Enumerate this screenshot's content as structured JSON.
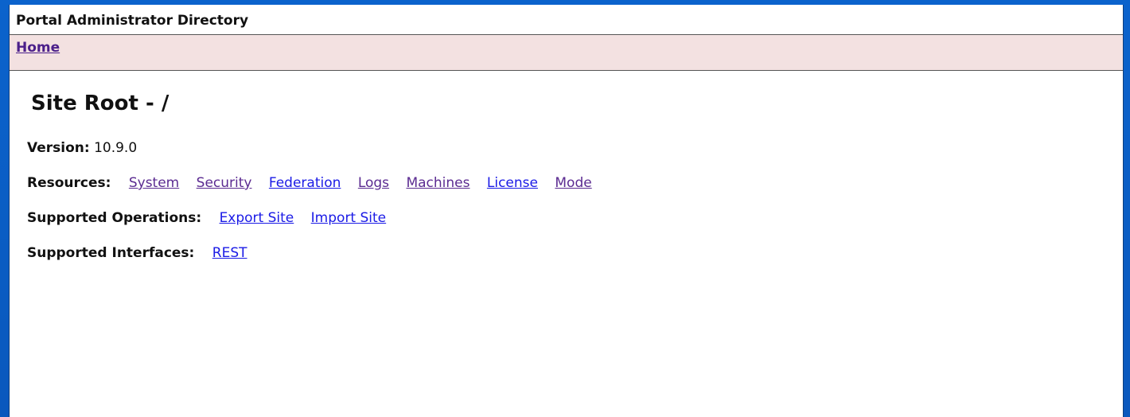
{
  "header": {
    "title": "Portal Administrator Directory"
  },
  "nav": {
    "home_label": "Home"
  },
  "page": {
    "title": "Site Root - /"
  },
  "version": {
    "label": "Version:",
    "value": "10.9.0"
  },
  "resources": {
    "label": "Resources:",
    "links": [
      "System",
      "Security",
      "Federation",
      "Logs",
      "Machines",
      "License",
      "Mode"
    ]
  },
  "operations": {
    "label": "Supported Operations:",
    "links": [
      "Export Site",
      "Import Site"
    ]
  },
  "interfaces": {
    "label": "Supported Interfaces:",
    "links": [
      "REST"
    ]
  },
  "colors": {
    "desktop_background": "#0b63cc",
    "nav_background": "#f3e1e1",
    "link": "#1a1ae6",
    "visited_link": "#5b2b91"
  }
}
